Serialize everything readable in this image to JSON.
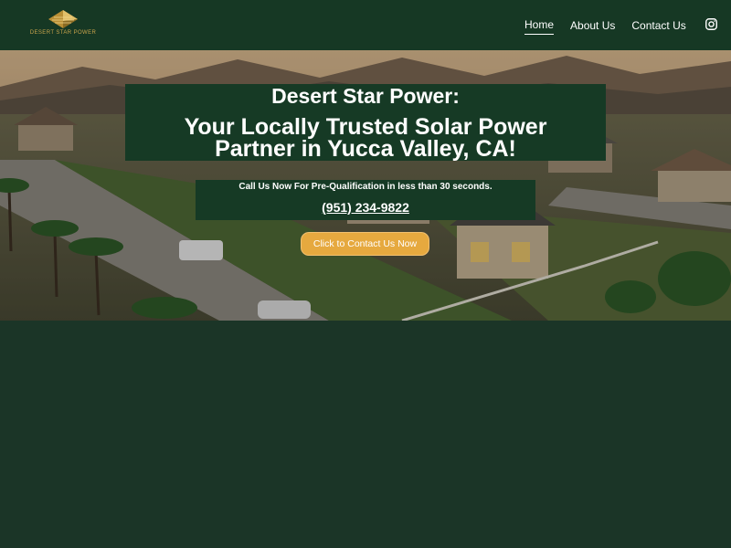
{
  "header": {
    "logo_text": "DESERT STAR POWER",
    "nav": [
      {
        "label": "Home",
        "active": true
      },
      {
        "label": "About Us",
        "active": false
      },
      {
        "label": "Contact Us",
        "active": false
      }
    ],
    "social_icon": "instagram-icon"
  },
  "hero": {
    "headline_line1": "Desert Star Power:",
    "headline_line2a": "Your Locally Trusted Solar Power",
    "headline_line2b": "Partner in Yucca Valley, CA!",
    "subtext": "Call Us Now For Pre-Qualification in less than 30 seconds.",
    "phone": "(951) 234-9822 ",
    "cta_label": "Click to Contact Us Now"
  },
  "colors": {
    "page_bg": "#1b3527",
    "header_bg": "#163824",
    "box_bg": "#163a25",
    "cta": "#e6a93f",
    "logo_gold": "#c9a44c"
  }
}
